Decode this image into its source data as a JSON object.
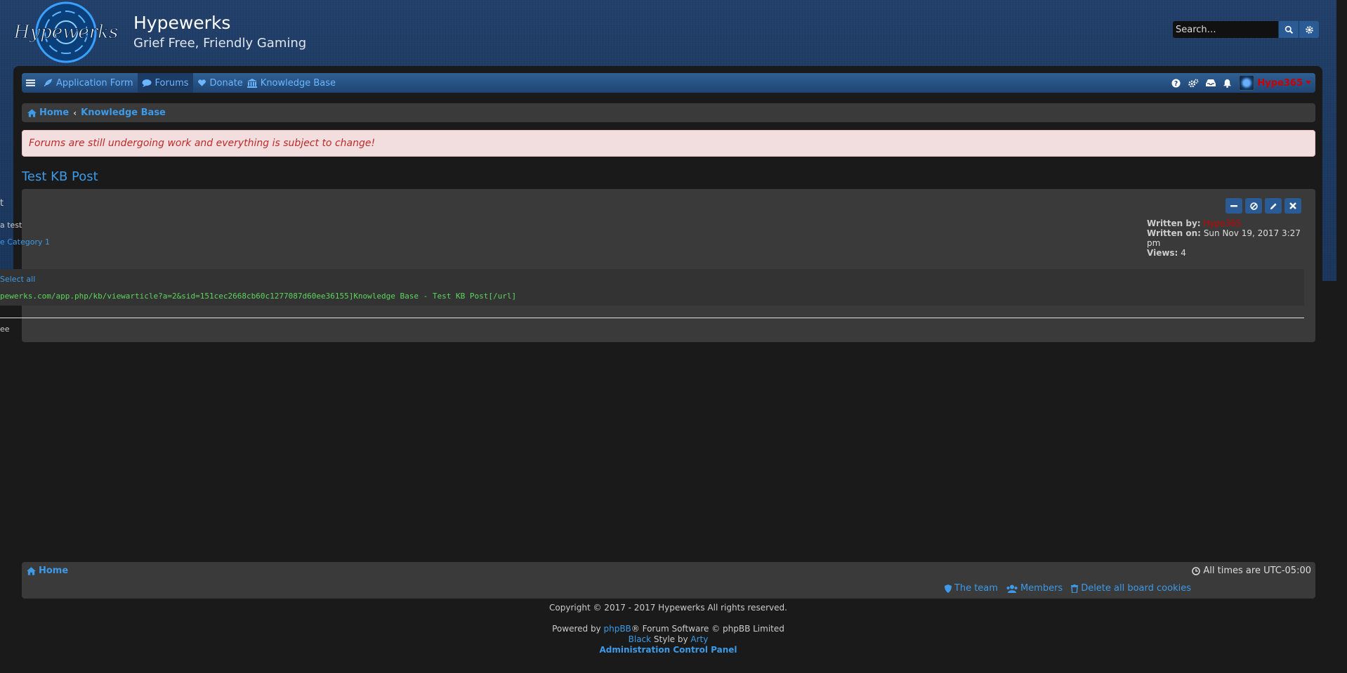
{
  "header": {
    "logo_text": "Hypewerks",
    "site_title": "Hypewerks",
    "site_description": "Grief Free, Friendly Gaming",
    "search_placeholder": "Search…"
  },
  "navbar": {
    "items": [
      {
        "label": "Application Form"
      },
      {
        "label": "Forums"
      },
      {
        "label": "Donate"
      },
      {
        "label": "Knowledge Base"
      }
    ],
    "username": "Hype365"
  },
  "breadcrumb": {
    "home": "Home",
    "current": "Knowledge Base"
  },
  "notice": "Forums are still undergoing work and everything is subject to change!",
  "article": {
    "title": "Test KB Post",
    "cut_heading": "t",
    "cut_body": "a test",
    "cut_category": "e Category 1",
    "written_by_label": "Written by:",
    "author": "Hype365",
    "written_on_label": "Written on:",
    "written_on": "Sun Nov 19, 2017 3:27 pm",
    "views_label": "Views:",
    "views": "4",
    "select_all": "Select all",
    "code": "pewerks.com/app.php/kb/viewarticle?a=2&sid=151cec2668cb60c1277087d60ee36155]Knowledge Base - Test KB Post[/url]",
    "cut_footer": "ee"
  },
  "footer": {
    "home": "Home",
    "timezone": "All times are UTC-05:00",
    "links": [
      "The team",
      "Members",
      "Delete all board cookies"
    ],
    "copyright": "Copyright © 2017 - 2017 Hypewerks All rights reserved.",
    "powered_prefix": "Powered by ",
    "phpbb": "phpBB",
    "powered_suffix": "® Forum Software © phpBB Limited",
    "style_name": "Black",
    "style_by": " Style by ",
    "style_author": "Arty",
    "acp": "Administration Control Panel"
  }
}
